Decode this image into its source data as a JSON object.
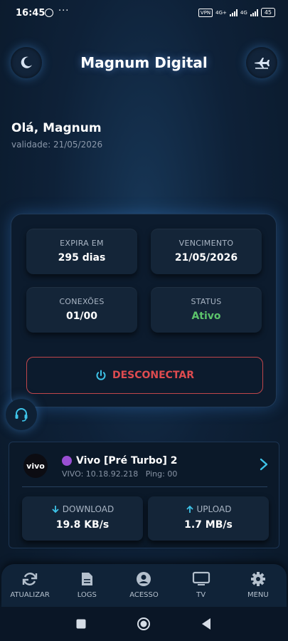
{
  "status_bar": {
    "time": "16:45",
    "dots": "···",
    "vpn": "VPN",
    "network1": "4G+",
    "network2": "4G",
    "battery": "45"
  },
  "header": {
    "title": "Magnum Digital",
    "left_icon": "moon-icon",
    "right_icon": "airplane-icon"
  },
  "user": {
    "greeting": "Olá, Magnum",
    "validity": "validade: 21/05/2026"
  },
  "account": {
    "tiles": [
      {
        "label": "EXPIRA EM",
        "value": "295 dias"
      },
      {
        "label": "VENCIMENTO",
        "value": "21/05/2026"
      },
      {
        "label": "CONEXÕES",
        "value": "01/00"
      },
      {
        "label": "STATUS",
        "value": "Ativo"
      }
    ],
    "disconnect_label": "DESCONECTAR"
  },
  "network": {
    "operator_logo": "vivo",
    "name": "Vivo [Pré Turbo] 2",
    "info": "VIVO: 10.18.92.218   Ping: 00",
    "download_label": "DOWNLOAD",
    "download_value": "19.8 KB/s",
    "upload_label": "UPLOAD",
    "upload_value": "1.7 MB/s"
  },
  "bottom_nav": [
    {
      "label": "ATUALIZAR",
      "icon": "refresh-icon"
    },
    {
      "label": "LOGS",
      "icon": "document-icon"
    },
    {
      "label": "ACESSO",
      "icon": "user-circle-icon"
    },
    {
      "label": "TV",
      "icon": "monitor-icon"
    },
    {
      "label": "MENU",
      "icon": "gear-icon"
    }
  ],
  "colors": {
    "accent": "#3ec3e8",
    "danger": "#de4b4f",
    "success": "#5cc46b",
    "operator_dot": "#9a4fd3"
  }
}
